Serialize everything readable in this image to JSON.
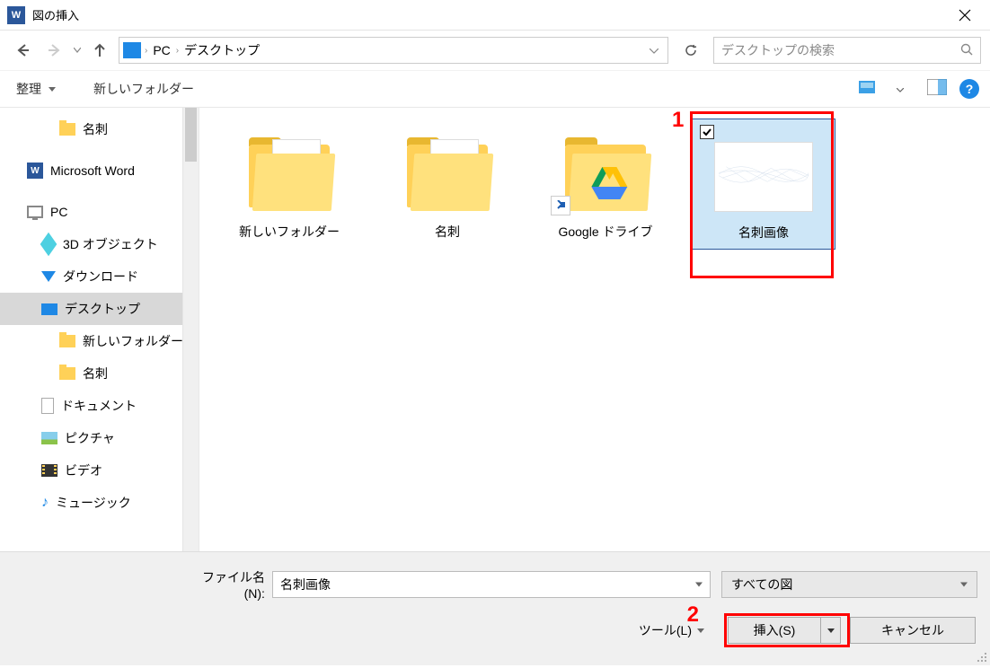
{
  "window": {
    "title": "図の挿入",
    "app_badge": "W"
  },
  "address": {
    "root": "PC",
    "folder": "デスクトップ"
  },
  "search": {
    "placeholder": "デスクトップの検索"
  },
  "toolbar": {
    "organize": "整理",
    "new_folder": "新しいフォルダー",
    "help": "?"
  },
  "tree": [
    {
      "label": "名刺",
      "icon": "folder",
      "level": 3
    },
    {
      "label": "Microsoft Word",
      "icon": "word",
      "level": 1,
      "gap": true
    },
    {
      "label": "PC",
      "icon": "pc",
      "level": 1,
      "gap": true
    },
    {
      "label": "3D オブジェクト",
      "icon": "3d",
      "level": 2
    },
    {
      "label": "ダウンロード",
      "icon": "dl",
      "level": 2
    },
    {
      "label": "デスクトップ",
      "icon": "desk",
      "level": 2,
      "selected": true
    },
    {
      "label": "新しいフォルダー",
      "icon": "folder",
      "level": 3
    },
    {
      "label": "名刺",
      "icon": "folder",
      "level": 3
    },
    {
      "label": "ドキュメント",
      "icon": "doc",
      "level": 2
    },
    {
      "label": "ピクチャ",
      "icon": "pic",
      "level": 2
    },
    {
      "label": "ビデオ",
      "icon": "vid",
      "level": 2
    },
    {
      "label": "ミュージック",
      "icon": "mus",
      "level": 2
    }
  ],
  "files": [
    {
      "label": "新しいフォルダー",
      "type": "folder",
      "inner": "blank"
    },
    {
      "label": "名刺",
      "type": "folder",
      "inner": "excel"
    },
    {
      "label": "Google ドライブ",
      "type": "folder",
      "inner": "gdrive",
      "shortcut": true
    },
    {
      "label": "名刺画像",
      "type": "image",
      "selected": true
    }
  ],
  "annotations": {
    "one": "1",
    "two": "2"
  },
  "bottom": {
    "filename_label": "ファイル名(N):",
    "filename_value": "名刺画像",
    "filter": "すべての図",
    "tools": "ツール(L)",
    "insert": "挿入(S)",
    "cancel": "キャンセル"
  }
}
